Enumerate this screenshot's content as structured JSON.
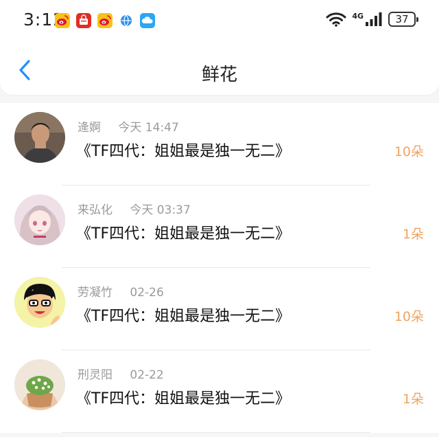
{
  "status_bar": {
    "time": "3:12",
    "network": "4G",
    "battery": "37",
    "notification_icons": [
      "weibo-icon",
      "pinduoduo-icon",
      "weibo-icon",
      "browser-icon",
      "cloud-icon"
    ]
  },
  "header": {
    "title": "鲜花",
    "back_icon": "chevron-left-icon"
  },
  "colors": {
    "accent": "#1e90ff",
    "count": "#f0a460",
    "meta": "#9a9a9a"
  },
  "records": [
    {
      "name": "逄婀",
      "time": "今天 14:47",
      "work": "《TF四代：姐姐最是独一无二》",
      "count": "10朵"
    },
    {
      "name": "来弘化",
      "time": "今天 03:37",
      "work": "《TF四代：姐姐最是独一无二》",
      "count": "1朵"
    },
    {
      "name": "劳凝竹",
      "time": "02-26",
      "work": "《TF四代：姐姐最是独一无二》",
      "count": "10朵"
    },
    {
      "name": "刑灵阳",
      "time": "02-22",
      "work": "《TF四代：姐姐最是独一无二》",
      "count": "1朵"
    }
  ]
}
